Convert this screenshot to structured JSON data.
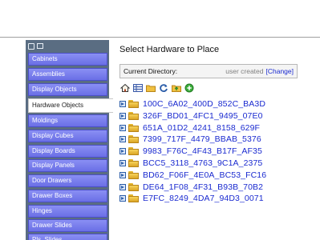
{
  "sidebar": {
    "items": [
      {
        "label": "Cabinets",
        "active": false
      },
      {
        "label": "Assemblies",
        "active": false
      },
      {
        "label": "Display Objects",
        "active": false
      },
      {
        "label": "Hardware Objects",
        "active": true
      },
      {
        "label": "Moldings",
        "active": false
      },
      {
        "label": "Display Cubes",
        "active": false
      },
      {
        "label": "Display Boards",
        "active": false
      },
      {
        "label": "Display Panels",
        "active": false
      },
      {
        "label": "Door Drawers",
        "active": false
      },
      {
        "label": "Drawer Boxes",
        "active": false
      },
      {
        "label": "Hinges",
        "active": false
      },
      {
        "label": "Drawer Slides",
        "active": false
      },
      {
        "label": "Pls. Slides",
        "active": false
      }
    ]
  },
  "main": {
    "title": "Select Hardware  to Place",
    "current_directory": {
      "label": "Current Directory:",
      "value": "user created",
      "change_link": "[Change]"
    },
    "toolbar": [
      "home-icon",
      "grid-icon",
      "folder-icon",
      "refresh-icon",
      "folder-up-icon",
      "add-icon"
    ],
    "items": [
      "100C_6A02_400D_852C_BA3D",
      "326F_BD01_4FC1_9495_07E0",
      "651A_01D2_4241_8158_629F",
      "7399_717F_4479_BBAB_5376",
      "9983_F76C_4F43_B17F_AF35",
      "BCC5_3118_4763_9C1A_2375",
      "BD62_F06F_4E0A_BC53_FC16",
      "DE64_1F08_4F31_B93B_70B2",
      "E7FC_8249_4DA7_94D3_0071"
    ]
  },
  "colors": {
    "sidebar_bg": "#5a6d82",
    "nav_button": "#7a7ff0",
    "link": "#1a2ad0",
    "folder": "#f0c040"
  }
}
